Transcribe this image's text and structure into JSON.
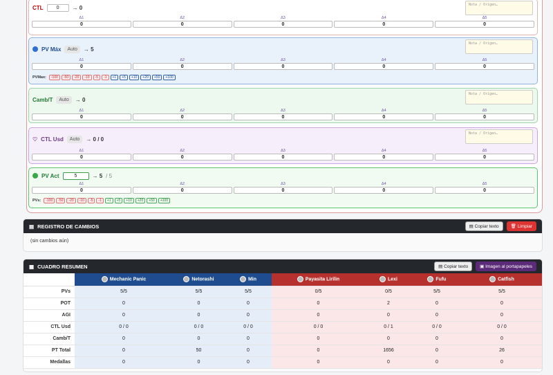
{
  "stats": [
    {
      "key": "ctl",
      "name": "CTL",
      "input": "0",
      "result": "→ 0",
      "note": "Nota / Origen…",
      "deltas": [
        "0",
        "0",
        "0",
        "0",
        "0"
      ]
    },
    {
      "key": "pvmax",
      "name": "PV Máx",
      "auto": "Auto",
      "result": "→ 5",
      "note": "Nota / Origen…",
      "deltas": [
        "0",
        "0",
        "0",
        "0",
        "0"
      ],
      "quick_label": "PVMax:",
      "quick": [
        "-100",
        "-50",
        "-20",
        "-10",
        "-5",
        "-1",
        "+1",
        "+5",
        "+10",
        "+20",
        "+50",
        "+100"
      ]
    },
    {
      "key": "camb",
      "name": "Camb/T",
      "auto": "Auto",
      "result": "→ 0",
      "note": "Nota / Origen…",
      "deltas": [
        "0",
        "0",
        "0",
        "0",
        "0"
      ]
    },
    {
      "key": "ctlusd",
      "name": "CTL Usd",
      "auto": "Auto",
      "result": "→ 0 / 0",
      "note": "Nota / Origen…",
      "deltas": [
        "0",
        "0",
        "0",
        "0",
        "0"
      ]
    },
    {
      "key": "pvact",
      "name": "PV Act",
      "input": "5",
      "result": "→ 5",
      "result_sub": "/ 5",
      "deltas": [
        "0",
        "0",
        "0",
        "0",
        "0"
      ],
      "quick_label": "PVs:",
      "quick": [
        "-100",
        "-50",
        "-20",
        "-10",
        "-5",
        "-1",
        "+1",
        "+5",
        "+10",
        "+20",
        "+50",
        "+100"
      ]
    }
  ],
  "delta_labels": [
    "Δ1",
    "Δ2",
    "Δ3",
    "Δ4",
    "Δ5"
  ],
  "log": {
    "title": "REGISTRO DE CAMBIOS",
    "copy": "Copiar texto",
    "clear": "Limpiar",
    "empty": "(sin cambios aún)"
  },
  "summary": {
    "title": "CUADRO RESUMEN",
    "copy": "Copiar texto",
    "image": "Imagen al portapapeles",
    "players": [
      {
        "name": "Mechanic Panic",
        "team": "blue"
      },
      {
        "name": "Netorashi",
        "team": "blue"
      },
      {
        "name": "Min",
        "team": "blue"
      },
      {
        "name": "Payasita Lirilin",
        "team": "red"
      },
      {
        "name": "Lexi",
        "team": "red"
      },
      {
        "name": "Fufu",
        "team": "red"
      },
      {
        "name": "Catfish",
        "team": "red"
      }
    ],
    "rows": [
      {
        "label": "PVs",
        "vals": [
          "5/5",
          "5/5",
          "5/5",
          "0/5",
          "0/5",
          "5/5",
          "5/5"
        ]
      },
      {
        "label": "POT",
        "vals": [
          "0",
          "0",
          "0",
          "0",
          "2",
          "0",
          "0"
        ]
      },
      {
        "label": "AGI",
        "vals": [
          "0",
          "0",
          "0",
          "0",
          "0",
          "0",
          "0"
        ]
      },
      {
        "label": "CTL Usd",
        "vals": [
          "0 / 0",
          "0 / 0",
          "0 / 0",
          "0 / 0",
          "0 / 1",
          "0 / 0",
          "0 / 0"
        ]
      },
      {
        "label": "Camb/T",
        "vals": [
          "0",
          "0",
          "0",
          "0",
          "0",
          "0",
          "0"
        ]
      },
      {
        "label": "PT Total",
        "vals": [
          "0",
          "50",
          "0",
          "0",
          "1656",
          "0",
          "26"
        ]
      },
      {
        "label": "Medallas",
        "vals": [
          "0",
          "0",
          "0",
          "0",
          "0",
          "0",
          "0"
        ]
      }
    ]
  },
  "colors": {
    "blue": "#1e4c8f",
    "red": "#b6302d"
  }
}
